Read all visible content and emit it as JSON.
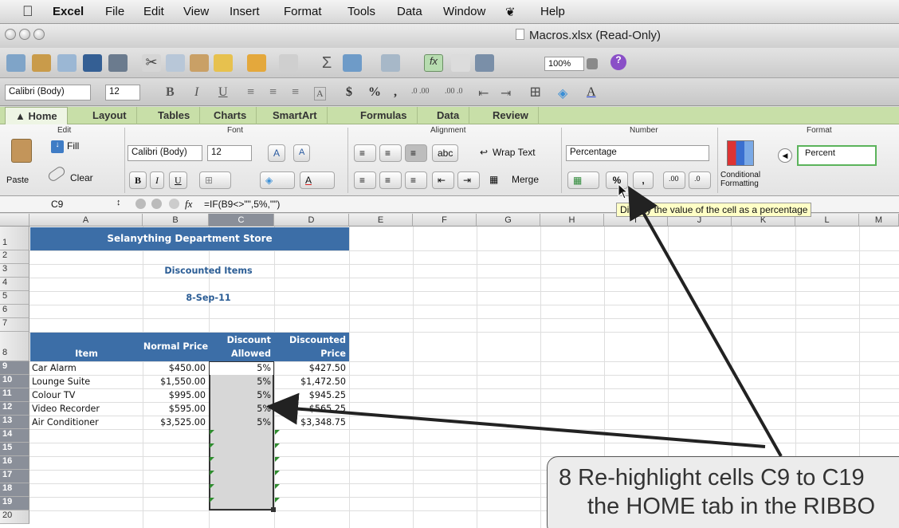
{
  "menubar": {
    "app": "Excel",
    "items": [
      "File",
      "Edit",
      "View",
      "Insert",
      "Format",
      "Tools",
      "Data",
      "Window",
      "Help"
    ]
  },
  "window": {
    "title": "Macros.xlsx  (Read-Only)"
  },
  "toolbar": {
    "zoom": "100%"
  },
  "format_bar": {
    "font": "Calibri (Body)",
    "size": "12",
    "currency": "$",
    "percent": "%",
    "comma": ",",
    "inc_decimal": ".0 .00",
    "dec_decimal": ".00 .0"
  },
  "tabs": [
    "Home",
    "Layout",
    "Tables",
    "Charts",
    "SmartArt",
    "Formulas",
    "Data",
    "Review"
  ],
  "ribbon": {
    "groups": {
      "edit": "Edit",
      "font": "Font",
      "alignment": "Alignment",
      "number": "Number",
      "format": "Format"
    },
    "fill": "Fill",
    "clear": "Clear",
    "paste": "Paste",
    "font_name": "Calibri (Body)",
    "font_size": "12",
    "grow": "A",
    "shrink": "A",
    "bold": "B",
    "italic": "I",
    "underline": "U",
    "abc": "abc",
    "wrap_text": "Wrap Text",
    "merge": "Merge",
    "number_format": "Percentage",
    "percent_btn": "%",
    "comma_btn": ",",
    "conditional_formatting": "Conditional Formatting",
    "style_sample": "Percent"
  },
  "formula_bar": {
    "cell_ref": "C9",
    "fx": "fx",
    "formula": "=IF(B9<>\"\",5%,\"\")"
  },
  "tooltip": "Display the value of the cell as a percentage",
  "columns": [
    "A",
    "B",
    "C",
    "D",
    "E",
    "F",
    "G",
    "H",
    "I",
    "J",
    "K",
    "L",
    "M"
  ],
  "rows": [
    "1",
    "2",
    "3",
    "4",
    "5",
    "6",
    "7",
    "8",
    "9",
    "10",
    "11",
    "12",
    "13",
    "14",
    "15",
    "16",
    "17",
    "18",
    "19",
    "20"
  ],
  "sheet": {
    "title": "Selanything Department Store",
    "subtitle": "Discounted Items",
    "date": "8-Sep-11",
    "headers": {
      "item": "Item",
      "normal_price": "Normal Price",
      "discount_1": "Discount",
      "discount_2": "Allowed",
      "discounted_1": "Discounted",
      "discounted_2": "Price"
    },
    "items": [
      {
        "item": "Car Alarm",
        "price": "$450.00",
        "discount": "5%",
        "final": "$427.50"
      },
      {
        "item": "Lounge Suite",
        "price": "$1,550.00",
        "discount": "5%",
        "final": "$1,472.50"
      },
      {
        "item": "Colour TV",
        "price": "$995.00",
        "discount": "5%",
        "final": "$945.25"
      },
      {
        "item": "Video Recorder",
        "price": "$595.00",
        "discount": "5%",
        "final": "$565.25"
      },
      {
        "item": "Air Conditioner",
        "price": "$3,525.00",
        "discount": "5%",
        "final": "$3,348.75"
      }
    ]
  },
  "callout": {
    "line1": "8 Re-highlight cells C9 to C19",
    "line2": "the HOME tab in the RIBBO"
  },
  "colors": {
    "header_blue": "#3c6ea7",
    "tab_green": "#c8dfa8",
    "tooltip_yellow": "#ffffc6"
  }
}
